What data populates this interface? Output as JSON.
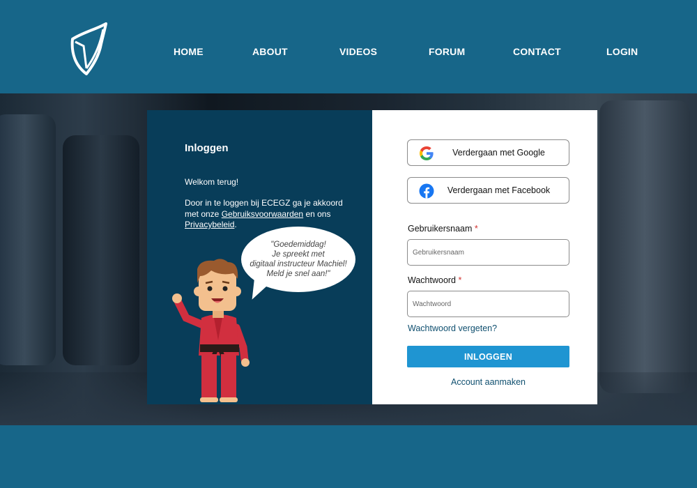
{
  "nav": {
    "items": [
      {
        "label": "HOME"
      },
      {
        "label": "ABOUT"
      },
      {
        "label": "VIDEOS"
      },
      {
        "label": "FORUM"
      },
      {
        "label": "CONTACT"
      },
      {
        "label": "LOGIN"
      }
    ]
  },
  "logo": {
    "icon": "shield-logo-icon"
  },
  "login_panel": {
    "title": "Inloggen",
    "welcome": "Welkom terug!",
    "terms_prefix": "Door in te loggen bij ECEGZ ga je akkoord met onze ",
    "terms_link": "Gebruiksvoorwaarden",
    "terms_middle": " en ons ",
    "privacy_link": "Privacybeleid",
    "terms_suffix": ".",
    "bubble_line1": "\"Goedemiddag!",
    "bubble_line2": "Je spreekt met",
    "bubble_line3": "digitaal instructeur Machiel!",
    "bubble_line4": "Meld je snel aan!\""
  },
  "form": {
    "google_label": "Verdergaan met Google",
    "facebook_label": "Verdergaan met Facebook",
    "username_label": "Gebruikersnaam",
    "username_placeholder": "Gebruikersnaam",
    "password_label": "Wachtwoord",
    "password_placeholder": "Wachtwoord",
    "required_mark": "*",
    "forgot_label": "Wachtwoord vergeten?",
    "submit_label": "INLOGGEN",
    "create_label": "Account aanmaken"
  },
  "colors": {
    "header_bg": "#176689",
    "panel_dark": "#083d59",
    "button_primary": "#1f95d2",
    "required": "#d0302e"
  }
}
